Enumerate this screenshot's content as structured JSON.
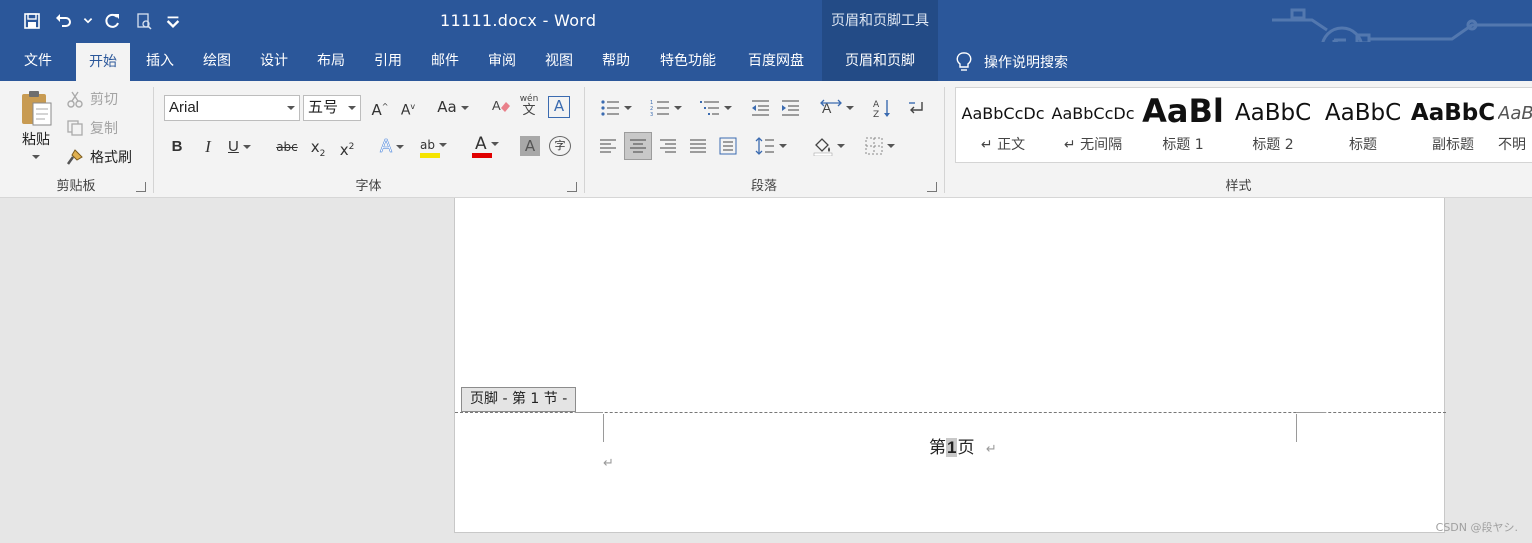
{
  "titlebar": {
    "doc_title": "11111.docx  -  Word",
    "context_title": "页眉和页脚工具",
    "qat": [
      "save-icon",
      "undo-icon",
      "redo-icon",
      "print-preview-icon",
      "customize-qat-icon"
    ]
  },
  "tabs": [
    {
      "label": "文件"
    },
    {
      "label": "开始"
    },
    {
      "label": "插入"
    },
    {
      "label": "绘图"
    },
    {
      "label": "设计"
    },
    {
      "label": "布局"
    },
    {
      "label": "引用"
    },
    {
      "label": "邮件"
    },
    {
      "label": "审阅"
    },
    {
      "label": "视图"
    },
    {
      "label": "帮助"
    },
    {
      "label": "特色功能"
    },
    {
      "label": "百度网盘"
    },
    {
      "label": "页眉和页脚"
    }
  ],
  "search": {
    "label": "操作说明搜索"
  },
  "clipboard": {
    "paste": "粘贴",
    "cut": "剪切",
    "copy": "复制",
    "format_painter": "格式刷",
    "label": "剪贴板"
  },
  "font": {
    "name": "Arial",
    "size": "五号",
    "label": "字体",
    "grow": "A",
    "shrink": "A",
    "case": "Aa",
    "phonetic_top": "wén",
    "phonetic_bottom": "文",
    "border_char": "A",
    "bold": "B",
    "italic": "I",
    "underline": "U",
    "strike": "abc",
    "subscript": "x",
    "superscript": "x",
    "sub_mark": "2",
    "sup_mark": "2",
    "effect": "A",
    "highlight": "ab",
    "color": "A",
    "shading": "A",
    "enclose": "字",
    "highlight_color": "#f5e400",
    "font_color": "#e00000"
  },
  "paragraph": {
    "label": "段落"
  },
  "styles": {
    "label": "样式",
    "items": [
      {
        "sample": "AaBbCcDc",
        "name": "↵ 正文"
      },
      {
        "sample": "AaBbCcDc",
        "name": "↵ 无间隔"
      },
      {
        "sample": "AaBl",
        "name": "标题 1"
      },
      {
        "sample": "AaBbC",
        "name": "标题 2"
      },
      {
        "sample": "AaBbC",
        "name": "标题"
      },
      {
        "sample": "AaBbC",
        "name": "副标题"
      },
      {
        "sample": "AaBb",
        "name": "不明"
      }
    ]
  },
  "document": {
    "footer_tag": "页脚 - 第 1 节 -",
    "footer_prefix": "第",
    "page_field": "1",
    "footer_suffix": "页",
    "para_mark": "↵"
  },
  "watermark": "CSDN @段ヤシ."
}
